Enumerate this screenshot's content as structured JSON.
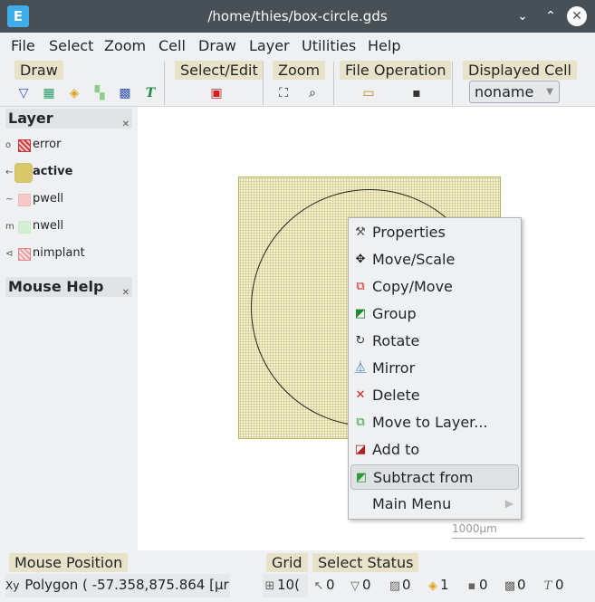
{
  "window": {
    "title": "/home/thies/box-circle.gds",
    "logo": "E"
  },
  "menubar": [
    "File",
    "Select",
    "Zoom",
    "Cell",
    "Draw",
    "Layer",
    "Utilities",
    "Help"
  ],
  "toolbar": {
    "groups": {
      "draw": "Draw",
      "select_edit": "Select/Edit",
      "zoom": "Zoom",
      "file_operation": "File Operation",
      "displayed_cell": "Displayed Cell"
    },
    "displayed_cell_value": "noname"
  },
  "layer_panel": {
    "title": "Layer",
    "layers": [
      {
        "name": "error",
        "color": "#d43c3c",
        "bold": false,
        "marker": "o"
      },
      {
        "name": "active",
        "color": "#d8c86a",
        "bold": true,
        "marker": "←"
      },
      {
        "name": "pwell",
        "color": "#f2b8b8",
        "bold": false,
        "marker": "~"
      },
      {
        "name": "nwell",
        "color": "#c6ebc6",
        "bold": false,
        "marker": "m"
      },
      {
        "name": "nimplant",
        "color": "#e9a0a0",
        "bold": false,
        "marker": "⊲"
      }
    ]
  },
  "mouse_help_panel": {
    "title": "Mouse Help"
  },
  "canvas": {
    "scale_label": "1000µm"
  },
  "context_menu": [
    {
      "label": "Properties",
      "icon": "hammer-icon"
    },
    {
      "label": "Move/Scale",
      "icon": "move-icon"
    },
    {
      "label": "Copy/Move",
      "icon": "copy-icon"
    },
    {
      "label": "Group",
      "icon": "group-icon"
    },
    {
      "label": "Rotate",
      "icon": "rotate-icon"
    },
    {
      "label": "Mirror",
      "icon": "mirror-icon"
    },
    {
      "label": "Delete",
      "icon": "delete-icon"
    },
    {
      "label": "Move to Layer...",
      "icon": "move-layer-icon"
    },
    {
      "label": "Add to",
      "icon": "add-to-icon"
    },
    {
      "label": "Subtract from",
      "icon": "subtract-icon",
      "highlighted": true
    },
    {
      "label": "Main Menu",
      "icon": "",
      "submenu": true
    }
  ],
  "statusbar": {
    "mouse_position_title": "Mouse Position",
    "mouse_position_value": "Polygon   ( -57.358,875.864 [µr",
    "grid_title": "Grid",
    "grid_value": "10(",
    "select_status_title": "Select Status",
    "select_counts": [
      "0",
      "0",
      "0",
      "1",
      "0",
      "0",
      "0"
    ]
  }
}
